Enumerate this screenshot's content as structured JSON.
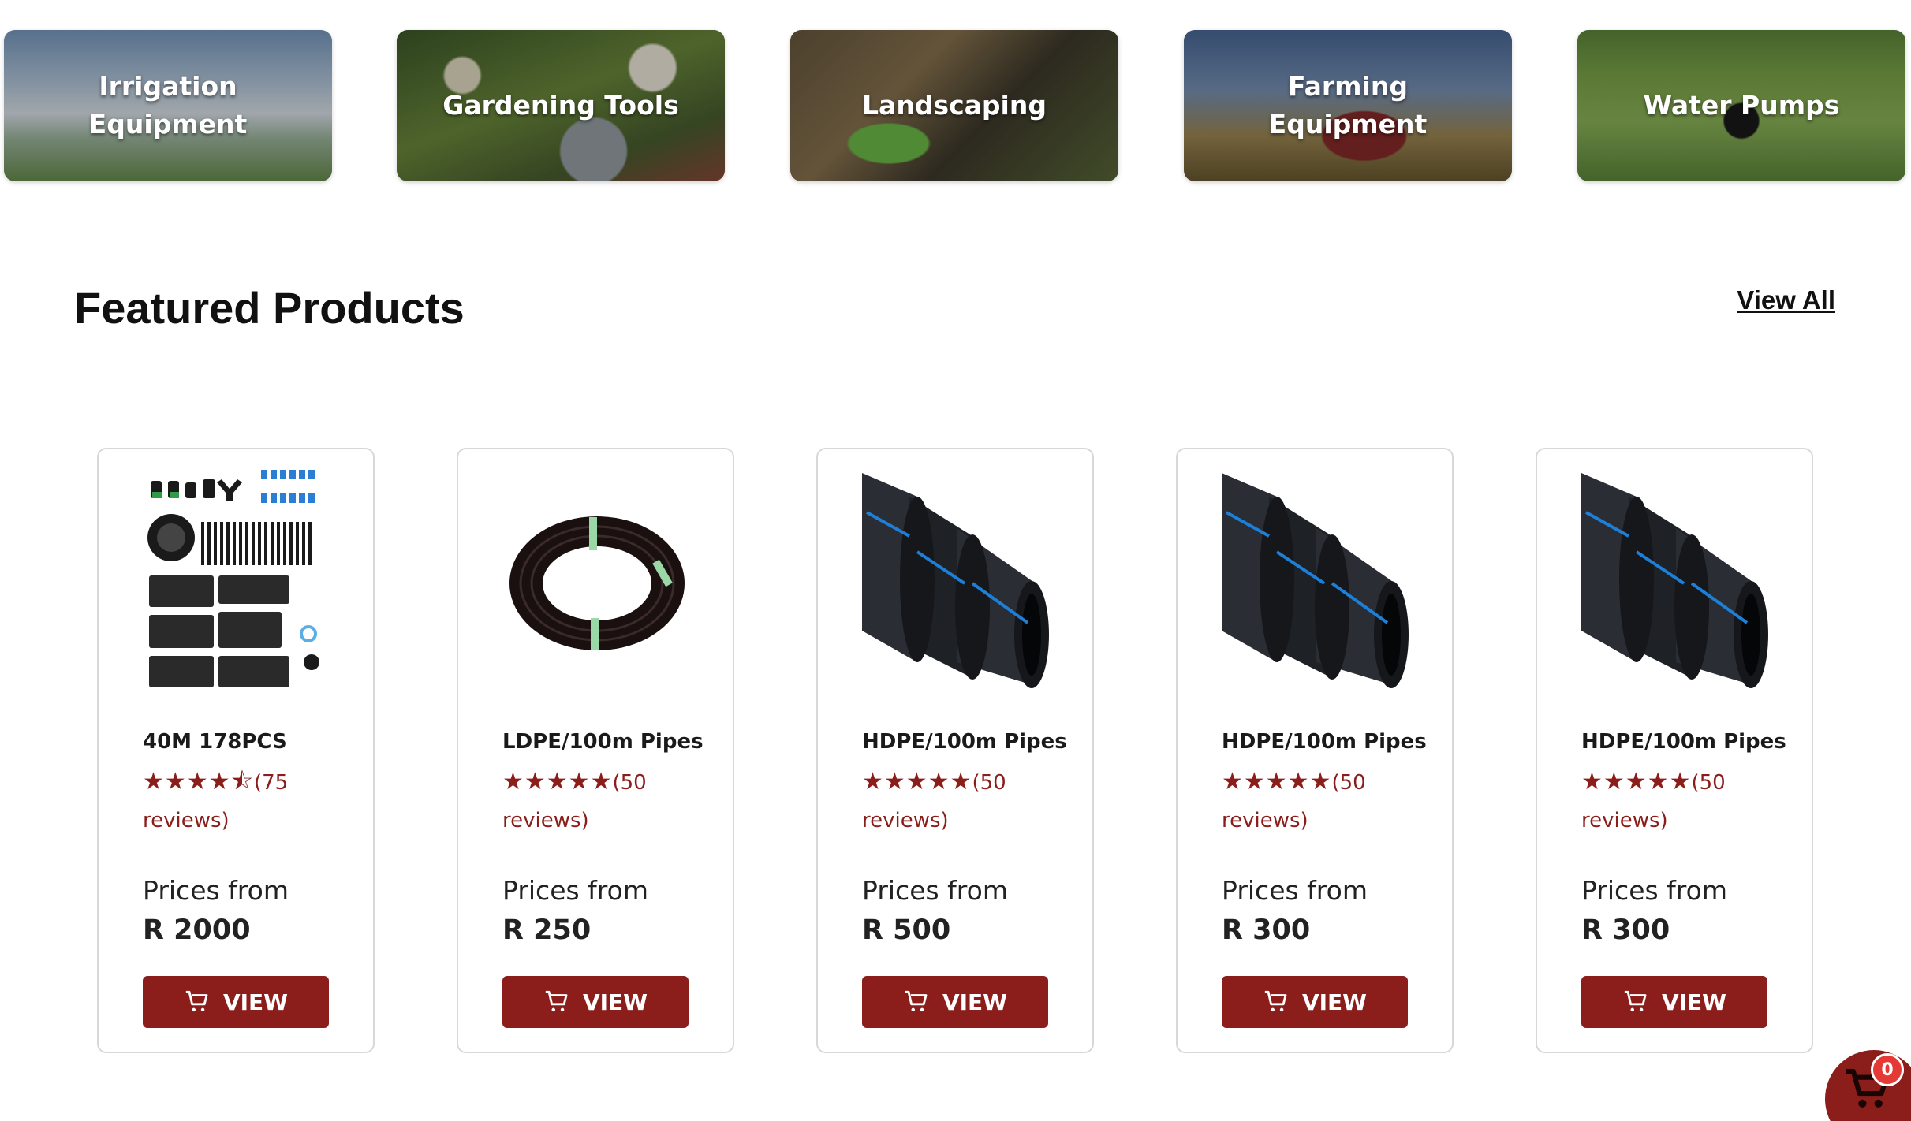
{
  "categories": [
    {
      "label": "Irrigation Equipment"
    },
    {
      "label": "Gardening Tools"
    },
    {
      "label": "Landscaping"
    },
    {
      "label": "Farming Equipment"
    },
    {
      "label": "Water Pumps"
    }
  ],
  "featured": {
    "title": "Featured Products",
    "view_all": "View All"
  },
  "products": [
    {
      "name": "40M 178PCS",
      "stars": "★★★★⯪",
      "reviews": "(75 reviews)",
      "price_label": "Prices from",
      "price": "R 2000",
      "button": "VIEW",
      "image_icon": "drip-kit-icon"
    },
    {
      "name": "LDPE/100m Pipes",
      "stars": "★★★★★",
      "reviews": "(50 reviews)",
      "price_label": "Prices from",
      "price": "R 250",
      "button": "VIEW",
      "image_icon": "pipe-coil-icon"
    },
    {
      "name": "HDPE/100m Pipes",
      "stars": "★★★★★",
      "reviews": "(50 reviews)",
      "price_label": "Prices from",
      "price": "R 500",
      "button": "VIEW",
      "image_icon": "hdpe-pipes-icon"
    },
    {
      "name": "HDPE/100m Pipes",
      "stars": "★★★★★",
      "reviews": "(50 reviews)",
      "price_label": "Prices from",
      "price": "R 300",
      "button": "VIEW",
      "image_icon": "hdpe-pipes-icon"
    },
    {
      "name": "HDPE/100m Pipes",
      "stars": "★★★★★",
      "reviews": "(50 reviews)",
      "price_label": "Prices from",
      "price": "R 300",
      "button": "VIEW",
      "image_icon": "hdpe-pipes-icon"
    }
  ],
  "cart": {
    "count": "0",
    "icon": "cart-icon"
  },
  "colors": {
    "accent": "#8b1d1a",
    "badge": "#e53935",
    "text": "#111111",
    "card_border": "#d8d8d8"
  }
}
